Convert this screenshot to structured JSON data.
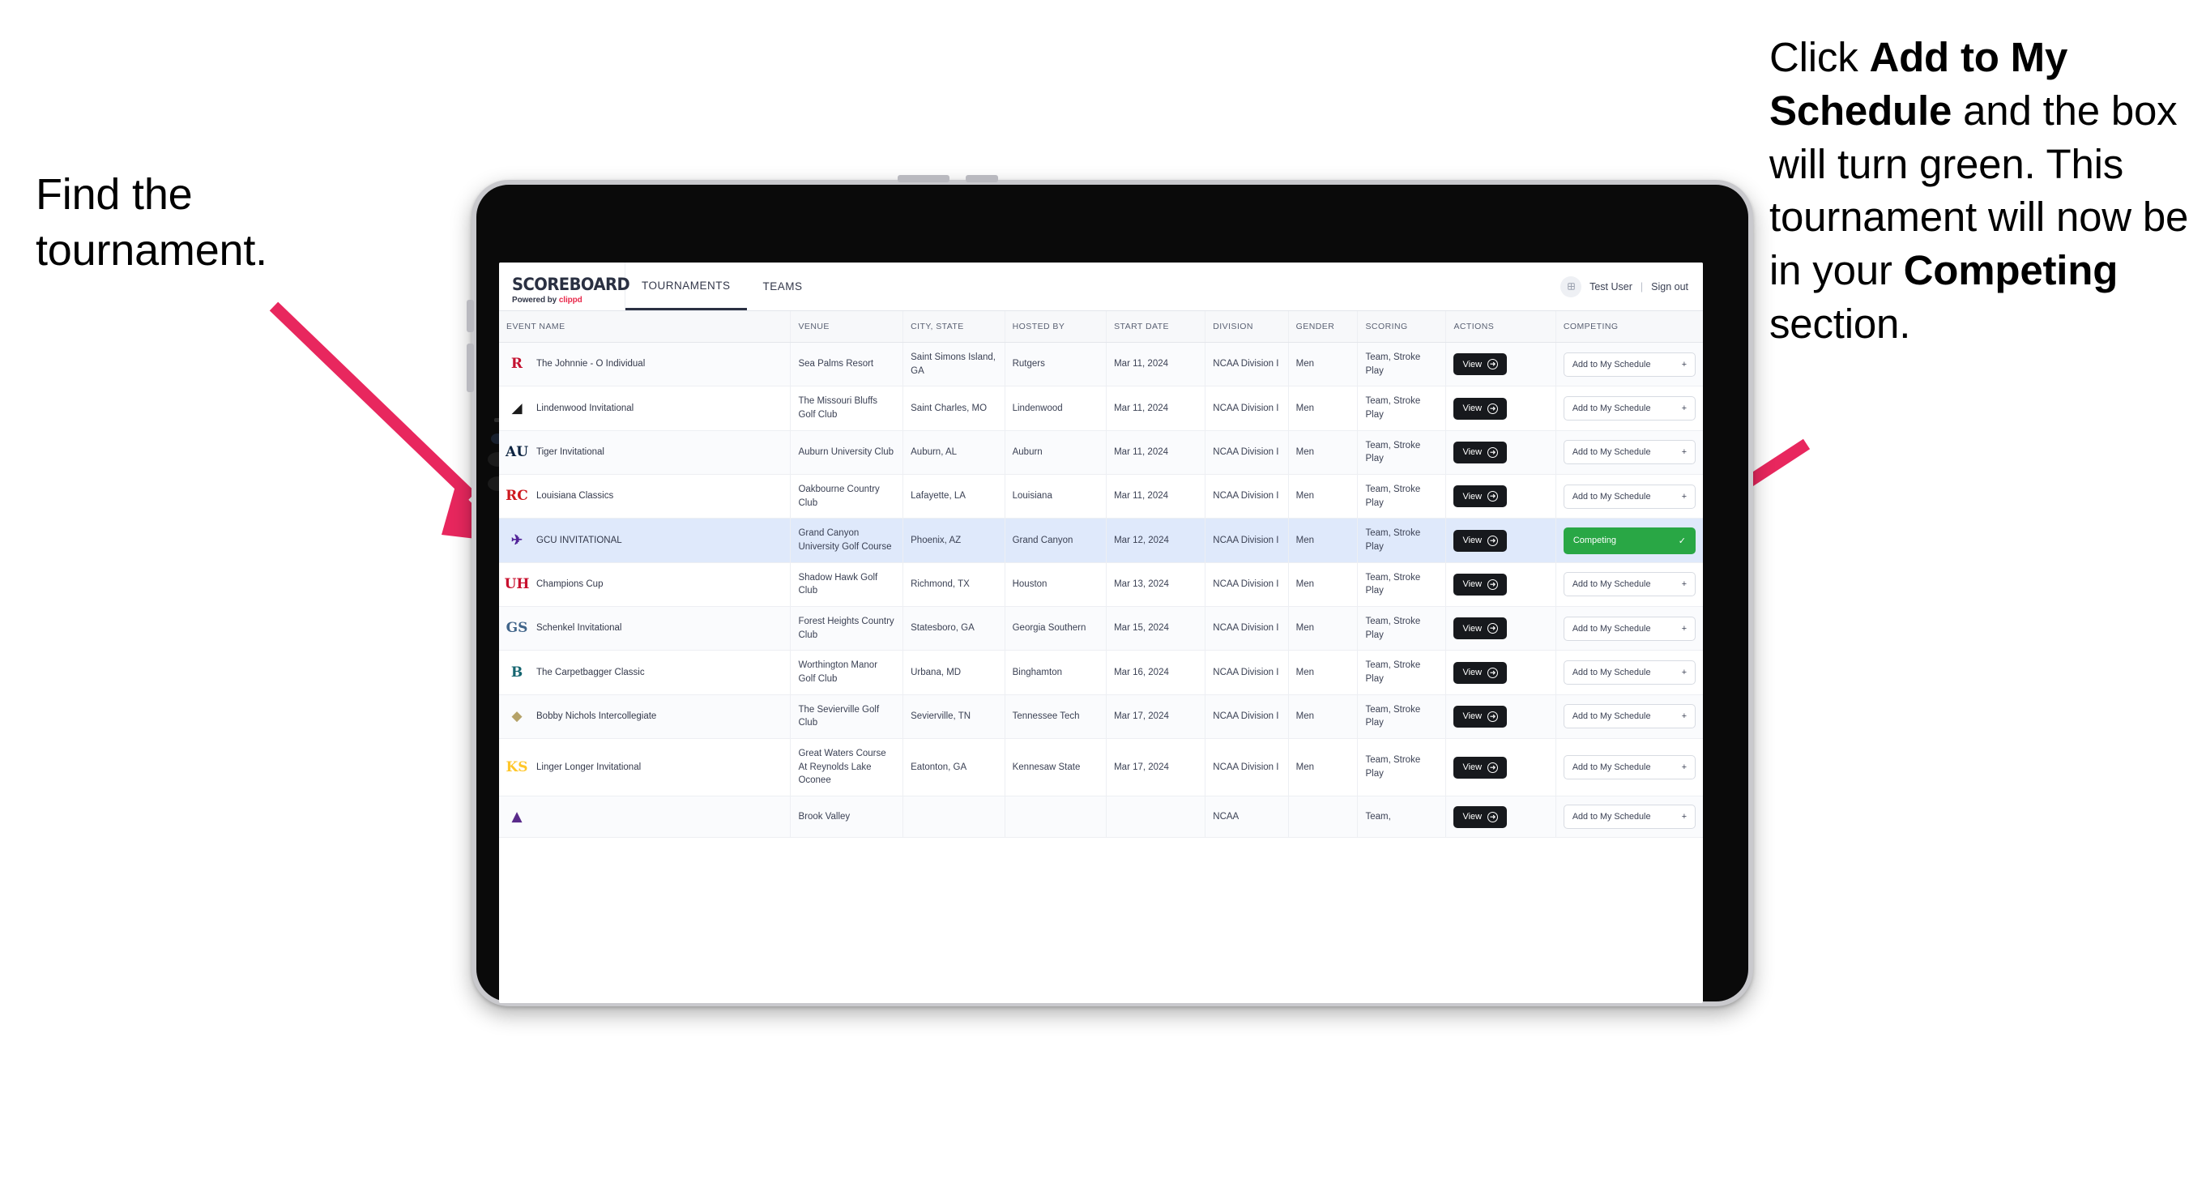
{
  "annotations": {
    "left": "Find the tournament.",
    "right_segments": [
      {
        "text": "Click ",
        "bold": false
      },
      {
        "text": "Add to My Schedule",
        "bold": true
      },
      {
        "text": " and the box will turn green. This tournament will now be in your ",
        "bold": false
      },
      {
        "text": "Competing",
        "bold": true
      },
      {
        "text": " section.",
        "bold": false
      }
    ],
    "arrow_color": "#e8275e"
  },
  "app": {
    "brand": {
      "title": "SCOREBOARD",
      "powered_prefix": "Powered by ",
      "powered_brand": "clippd"
    },
    "tabs": [
      {
        "label": "TOURNAMENTS",
        "active": true
      },
      {
        "label": "TEAMS",
        "active": false
      }
    ],
    "user": {
      "name": "Test User",
      "separator": "|",
      "sign_out": "Sign out",
      "avatar_icon": "user-avatar-icon"
    },
    "table": {
      "columns": [
        "EVENT NAME",
        "VENUE",
        "CITY, STATE",
        "HOSTED BY",
        "START DATE",
        "DIVISION",
        "GENDER",
        "SCORING",
        "ACTIONS",
        "COMPETING"
      ],
      "view_label": "View",
      "add_label": "Add to My Schedule",
      "add_icon": "plus-icon",
      "competing_label": "Competing",
      "competing_icon": "check-icon",
      "rows": [
        {
          "event": "The Johnnie - O Individual",
          "logo": "R",
          "logo_color": "#c41230",
          "logo_bg": "transparent",
          "venue": "Sea Palms Resort",
          "city": "Saint Simons Island, GA",
          "host": "Rutgers",
          "start": "Mar 11, 2024",
          "division": "NCAA Division I",
          "gender": "Men",
          "scoring": "Team, Stroke Play",
          "competing": false
        },
        {
          "event": "Lindenwood Invitational",
          "logo": "◢",
          "logo_color": "#1a1a1a",
          "logo_bg": "transparent",
          "venue": "The Missouri Bluffs Golf Club",
          "city": "Saint Charles, MO",
          "host": "Lindenwood",
          "start": "Mar 11, 2024",
          "division": "NCAA Division I",
          "gender": "Men",
          "scoring": "Team, Stroke Play",
          "competing": false
        },
        {
          "event": "Tiger Invitational",
          "logo": "AU",
          "logo_color": "#0c2340",
          "logo_bg": "transparent",
          "venue": "Auburn University Club",
          "city": "Auburn, AL",
          "host": "Auburn",
          "start": "Mar 11, 2024",
          "division": "NCAA Division I",
          "gender": "Men",
          "scoring": "Team, Stroke Play",
          "competing": false
        },
        {
          "event": "Louisiana Classics",
          "logo": "RC",
          "logo_color": "#ce181e",
          "logo_bg": "transparent",
          "venue": "Oakbourne Country Club",
          "city": "Lafayette, LA",
          "host": "Louisiana",
          "start": "Mar 11, 2024",
          "division": "NCAA Division I",
          "gender": "Men",
          "scoring": "Team, Stroke Play",
          "competing": false
        },
        {
          "event": "GCU INVITATIONAL",
          "logo": "✈",
          "logo_color": "#522398",
          "logo_bg": "transparent",
          "venue": "Grand Canyon University Golf Course",
          "city": "Phoenix, AZ",
          "host": "Grand Canyon",
          "start": "Mar 12, 2024",
          "division": "NCAA Division I",
          "gender": "Men",
          "scoring": "Team, Stroke Play",
          "competing": true,
          "selected": true
        },
        {
          "event": "Champions Cup",
          "logo": "UH",
          "logo_color": "#c8102e",
          "logo_bg": "transparent",
          "venue": "Shadow Hawk Golf Club",
          "city": "Richmond, TX",
          "host": "Houston",
          "start": "Mar 13, 2024",
          "division": "NCAA Division I",
          "gender": "Men",
          "scoring": "Team, Stroke Play",
          "competing": false
        },
        {
          "event": "Schenkel Invitational",
          "logo": "GS",
          "logo_color": "#41658a",
          "logo_bg": "transparent",
          "venue": "Forest Heights Country Club",
          "city": "Statesboro, GA",
          "host": "Georgia Southern",
          "start": "Mar 15, 2024",
          "division": "NCAA Division I",
          "gender": "Men",
          "scoring": "Team, Stroke Play",
          "competing": false
        },
        {
          "event": "The Carpetbagger Classic",
          "logo": "B",
          "logo_color": "#156570",
          "logo_bg": "transparent",
          "venue": "Worthington Manor Golf Club",
          "city": "Urbana, MD",
          "host": "Binghamton",
          "start": "Mar 16, 2024",
          "division": "NCAA Division I",
          "gender": "Men",
          "scoring": "Team, Stroke Play",
          "competing": false
        },
        {
          "event": "Bobby Nichols Intercollegiate",
          "logo": "◆",
          "logo_color": "#b5a268",
          "logo_bg": "transparent",
          "venue": "The Sevierville Golf Club",
          "city": "Sevierville, TN",
          "host": "Tennessee Tech",
          "start": "Mar 17, 2024",
          "division": "NCAA Division I",
          "gender": "Men",
          "scoring": "Team, Stroke Play",
          "competing": false
        },
        {
          "event": "Linger Longer Invitational",
          "logo": "KS",
          "logo_color": "#ffc629",
          "logo_bg": "transparent",
          "venue": "Great Waters Course At Reynolds Lake Oconee",
          "city": "Eatonton, GA",
          "host": "Kennesaw State",
          "start": "Mar 17, 2024",
          "division": "NCAA Division I",
          "gender": "Men",
          "scoring": "Team, Stroke Play",
          "competing": false
        },
        {
          "event": "",
          "logo": "▲",
          "logo_color": "#592a8a",
          "logo_bg": "transparent",
          "venue": "Brook Valley",
          "city": "",
          "host": "",
          "start": "",
          "division": "NCAA",
          "gender": "",
          "scoring": "Team,",
          "competing": false,
          "partial": true
        }
      ]
    }
  }
}
